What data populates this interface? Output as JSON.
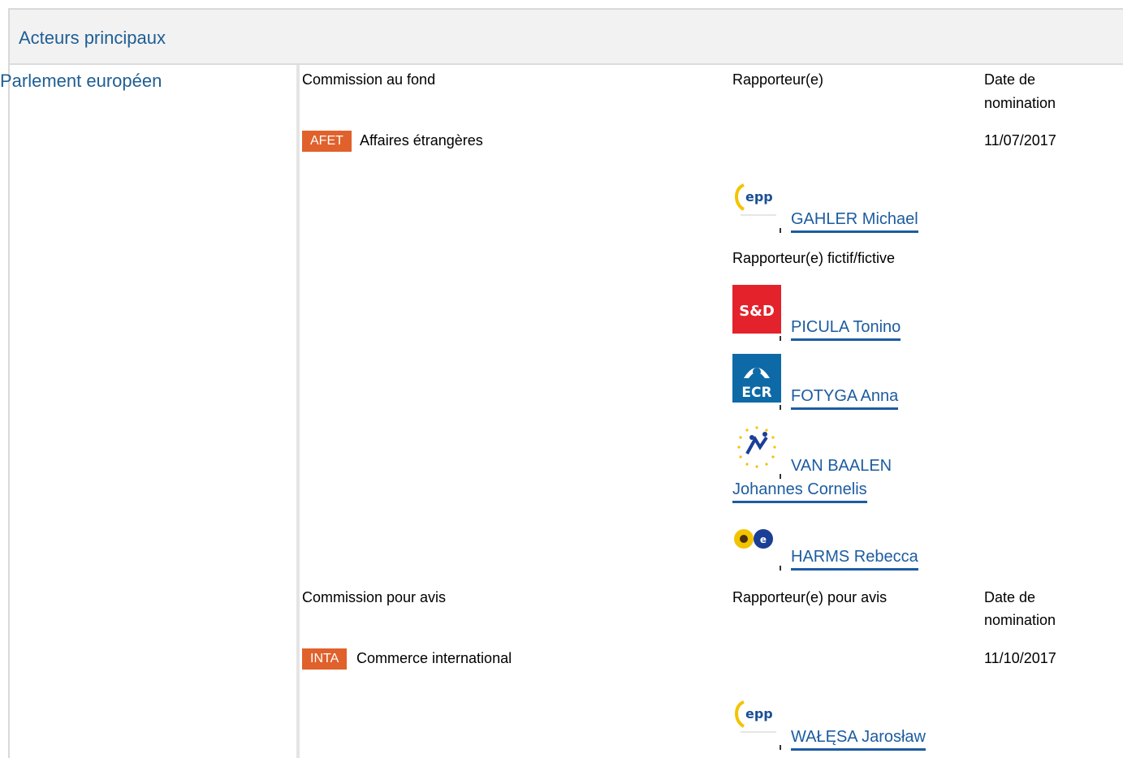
{
  "header": {
    "title": "Acteurs principaux"
  },
  "sidebar": {
    "title": "Parlement européen"
  },
  "fond": {
    "col_commission": "Commission au fond",
    "col_rapporteur": "Rapporteur(e)",
    "col_date_line1": "Date de",
    "col_date_line2": "nomination",
    "committee_code": "AFET",
    "committee_name": "Affaires étrangères",
    "date": "11/07/2017",
    "rapporteur": {
      "name": "GAHLER Michael",
      "group_icon": "epp-logo-icon"
    },
    "shadow_label": "Rapporteur(e) fictif/fictive",
    "shadows": [
      {
        "name": "PICULA Tonino",
        "group_icon": "sd-logo-icon",
        "logo_text": "S&D"
      },
      {
        "name": "FOTYGA Anna",
        "group_icon": "ecr-logo-icon",
        "logo_text": "ECR"
      },
      {
        "name_line1": "VAN BAALEN",
        "name_line2": "Johannes Cornelis",
        "group_icon": "alde-logo-icon"
      },
      {
        "name": "HARMS Rebecca",
        "group_icon": "greens-efa-logo-icon"
      }
    ]
  },
  "avis": {
    "col_commission": "Commission pour avis",
    "col_rapporteur": "Rapporteur(e) pour avis",
    "col_date_line1": "Date de",
    "col_date_line2": "nomination",
    "committee_code": "INTA",
    "committee_name": "Commerce international",
    "date": "11/10/2017",
    "rapporteur": {
      "name": "WAŁĘSA Jarosław",
      "group_icon": "epp-logo-icon"
    }
  },
  "logos": {
    "epp_text": "epp",
    "sd_text": "S&D",
    "ecr_text": "ECR"
  },
  "colors": {
    "accent": "#1d5ca0",
    "badge": "#e0612b",
    "sd_red": "#e3222b",
    "ecr_blue": "#0e6aa6"
  }
}
